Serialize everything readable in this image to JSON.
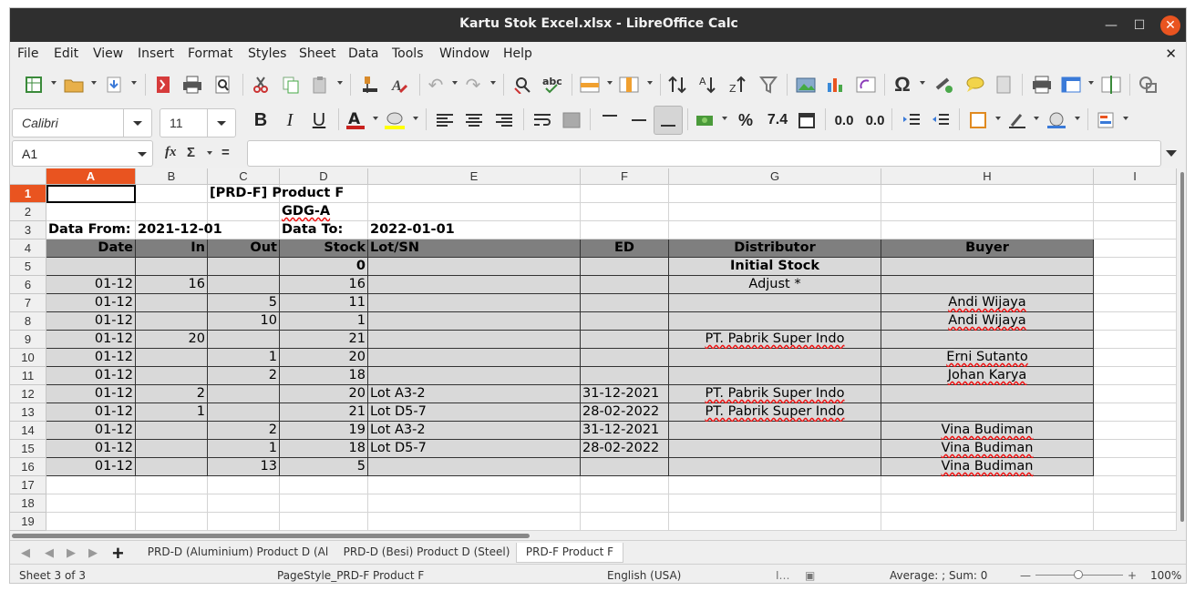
{
  "window": {
    "title": "Kartu Stok Excel.xlsx - LibreOffice Calc"
  },
  "menu": [
    "File",
    "Edit",
    "View",
    "Insert",
    "Format",
    "Styles",
    "Sheet",
    "Data",
    "Tools",
    "Window",
    "Help"
  ],
  "font": {
    "name": "Calibri",
    "size": "11"
  },
  "formula_bar": {
    "cell_ref": "A1",
    "fx": "fx",
    "sigma": "Σ",
    "equals": "=",
    "content": ""
  },
  "toolbar2": {
    "percent": "%",
    "number": "7.4",
    "add_decimal": "0.0",
    "del_decimal": "0.0"
  },
  "columns": [
    {
      "letter": "A"
    },
    {
      "letter": "B"
    },
    {
      "letter": "C"
    },
    {
      "letter": "D"
    },
    {
      "letter": "E"
    },
    {
      "letter": "F"
    },
    {
      "letter": "G"
    },
    {
      "letter": "H"
    },
    {
      "letter": "I"
    }
  ],
  "rows": [
    "1",
    "2",
    "3",
    "4",
    "5",
    "6",
    "7",
    "8",
    "9",
    "10",
    "11",
    "12",
    "13",
    "14",
    "15",
    "16",
    "17",
    "18",
    "19"
  ],
  "sheet": {
    "product_title": "[PRD-F] Product F",
    "warehouse": "GDG-A",
    "data_from_label": "Data From:",
    "data_from_value": "2021-12-01",
    "data_to_label": "Data To:",
    "data_to_value": "2022-01-01",
    "headers": [
      "Date",
      "In",
      "Out",
      "Stock",
      "Lot/SN",
      "ED",
      "Distributor",
      "Buyer"
    ],
    "initial_row": {
      "stock": "0",
      "distributor": "Initial Stock"
    },
    "data_rows": [
      {
        "date": "01-12",
        "in": "16",
        "out": "",
        "stock": "16",
        "lot": "",
        "ed": "",
        "distributor": "Adjust *",
        "buyer": ""
      },
      {
        "date": "01-12",
        "in": "",
        "out": "5",
        "stock": "11",
        "lot": "",
        "ed": "",
        "distributor": "",
        "buyer": "Andi Wijaya"
      },
      {
        "date": "01-12",
        "in": "",
        "out": "10",
        "stock": "1",
        "lot": "",
        "ed": "",
        "distributor": "",
        "buyer": "Andi Wijaya"
      },
      {
        "date": "01-12",
        "in": "20",
        "out": "",
        "stock": "21",
        "lot": "",
        "ed": "",
        "distributor": "PT. Pabrik Super Indo",
        "buyer": ""
      },
      {
        "date": "01-12",
        "in": "",
        "out": "1",
        "stock": "20",
        "lot": "",
        "ed": "",
        "distributor": "",
        "buyer": "Erni Sutanto"
      },
      {
        "date": "01-12",
        "in": "",
        "out": "2",
        "stock": "18",
        "lot": "",
        "ed": "",
        "distributor": "",
        "buyer": "Johan Karya"
      },
      {
        "date": "01-12",
        "in": "2",
        "out": "",
        "stock": "20",
        "lot": "Lot A3-2",
        "ed": "31-12-2021",
        "distributor": "PT. Pabrik Super Indo",
        "buyer": ""
      },
      {
        "date": "01-12",
        "in": "1",
        "out": "",
        "stock": "21",
        "lot": "Lot D5-7",
        "ed": "28-02-2022",
        "distributor": "PT. Pabrik Super Indo",
        "buyer": ""
      },
      {
        "date": "01-12",
        "in": "",
        "out": "2",
        "stock": "19",
        "lot": "Lot A3-2",
        "ed": "31-12-2021",
        "distributor": "",
        "buyer": "Vina Budiman"
      },
      {
        "date": "01-12",
        "in": "",
        "out": "1",
        "stock": "18",
        "lot": "Lot D5-7",
        "ed": "28-02-2022",
        "distributor": "",
        "buyer": "Vina Budiman"
      },
      {
        "date": "01-12",
        "in": "",
        "out": "13",
        "stock": "5",
        "lot": "",
        "ed": "",
        "distributor": "",
        "buyer": "Vina Budiman"
      }
    ]
  },
  "tabs": [
    "PRD-D (Aluminium) Product D (Al",
    "PRD-D (Besi) Product D (Steel)",
    "PRD-F Product F"
  ],
  "status": {
    "sheet": "Sheet 3 of 3",
    "page_style": "PageStyle_PRD-F Product F",
    "language": "English (USA)",
    "summary": "Average: ; Sum: 0",
    "zoom": "100%"
  },
  "colors": {
    "accent": "#e95420",
    "header_fill": "#7f7f7f",
    "row_fill": "#d9d9d9",
    "titlebar": "#2f2f2f"
  }
}
